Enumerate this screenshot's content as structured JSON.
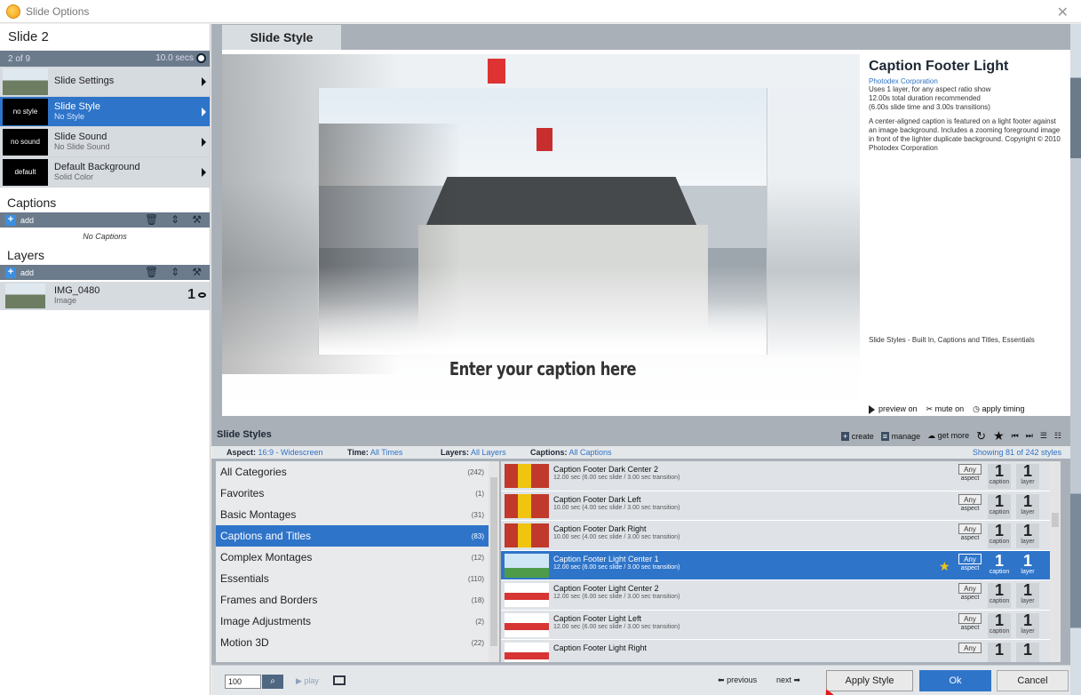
{
  "window": {
    "title": "Slide Options",
    "close": "✕"
  },
  "slide": {
    "title": "Slide 2",
    "position": "2 of 9",
    "duration": "10.0 secs"
  },
  "left_options": [
    {
      "thumb": "",
      "label": "Slide Settings",
      "sub": ""
    },
    {
      "thumb": "no style",
      "label": "Slide Style",
      "sub": "No Style"
    },
    {
      "thumb": "no sound",
      "label": "Slide Sound",
      "sub": "No Slide Sound"
    },
    {
      "thumb": "default",
      "label": "Default Background",
      "sub": "Solid Color"
    }
  ],
  "captions": {
    "title": "Captions",
    "add": "add",
    "empty": "No Captions"
  },
  "layers": {
    "title": "Layers",
    "add": "add",
    "items": [
      {
        "name": "IMG_0480",
        "type": "Image",
        "number": "1"
      }
    ]
  },
  "tab": {
    "label": "Slide Style"
  },
  "preview": {
    "caption": "Enter your caption here",
    "style_name": "Caption Footer Light",
    "company": "Photodex Corporation",
    "meta_lines": [
      "Uses 1 layer, for any aspect ratio show",
      "12.00s total duration recommended",
      "(6.00s slide time and 3.00s transitions)"
    ],
    "description": "A center-aligned caption is featured on a light footer against an image background. Includes a zooming foreground image in front of the lighter duplicate background. Copyright © 2010 Photodex Corporation",
    "categories": "Slide Styles - Built In, Captions and Titles, Essentials",
    "actions": {
      "preview": "preview on",
      "mute": "mute on",
      "timing": "apply timing"
    }
  },
  "styles_panel": {
    "title": "Slide Styles",
    "tools": {
      "create": "create",
      "manage": "manage",
      "get_more": "get more"
    },
    "filters": {
      "aspect_label": "Aspect:",
      "aspect_value": "16:9 - Widescreen",
      "time_label": "Time:",
      "time_value": "All Times",
      "layers_label": "Layers:",
      "layers_value": "All Layers",
      "captions_label": "Captions:",
      "captions_value": "All Captions",
      "showing": "Showing 81 of 242 styles"
    },
    "categories": [
      {
        "name": "All Categories",
        "count": "(242)"
      },
      {
        "name": "Favorites",
        "count": "(1)"
      },
      {
        "name": "Basic Montages",
        "count": "(31)"
      },
      {
        "name": "Captions and Titles",
        "count": "(83)"
      },
      {
        "name": "Complex Montages",
        "count": "(12)"
      },
      {
        "name": "Essentials",
        "count": "(110)"
      },
      {
        "name": "Frames and Borders",
        "count": "(18)"
      },
      {
        "name": "Image Adjustments",
        "count": "(2)"
      },
      {
        "name": "Motion 3D",
        "count": "(22)"
      }
    ],
    "selected_category": 3,
    "styles": [
      {
        "name": "Caption Footer Dark Center 2",
        "duration": "12.00 sec (6.00 sec slide / 3.00 sec transition)",
        "aspect": "Any",
        "aspect_label": "aspect",
        "captions": "1",
        "captions_label": "caption",
        "layers": "1",
        "layers_label": "layer"
      },
      {
        "name": "Caption Footer Dark Left",
        "duration": "10.00 sec (4.00 sec slide / 3.00 sec transition)",
        "aspect": "Any",
        "aspect_label": "aspect",
        "captions": "1",
        "captions_label": "caption",
        "layers": "1",
        "layers_label": "layer"
      },
      {
        "name": "Caption Footer Dark Right",
        "duration": "10.00 sec (4.00 sec slide / 3.00 sec transition)",
        "aspect": "Any",
        "aspect_label": "aspect",
        "captions": "1",
        "captions_label": "caption",
        "layers": "1",
        "layers_label": "layer"
      },
      {
        "name": "Caption Footer Light Center 1",
        "duration": "12.00 sec (6.00 sec slide / 3.00 sec transition)",
        "aspect": "Any",
        "aspect_label": "aspect",
        "captions": "1",
        "captions_label": "caption",
        "layers": "1",
        "layers_label": "layer"
      },
      {
        "name": "Caption Footer Light Center 2",
        "duration": "12.00 sec (6.00 sec slide / 3.00 sec transition)",
        "aspect": "Any",
        "aspect_label": "aspect",
        "captions": "1",
        "captions_label": "caption",
        "layers": "1",
        "layers_label": "layer"
      },
      {
        "name": "Caption Footer Light Left",
        "duration": "12.00 sec (6.00 sec slide / 3.00 sec transition)",
        "aspect": "Any",
        "aspect_label": "aspect",
        "captions": "1",
        "captions_label": "caption",
        "layers": "1",
        "layers_label": "layer"
      },
      {
        "name": "Caption Footer Light Right",
        "duration": "",
        "aspect": "Any",
        "aspect_label": "",
        "captions": "1",
        "captions_label": "",
        "layers": "1",
        "layers_label": ""
      }
    ],
    "selected_style": 3
  },
  "bottom": {
    "zoom": "100",
    "play": "play",
    "previous": "previous",
    "next": "next",
    "apply": "Apply Style",
    "ok": "Ok",
    "cancel": "Cancel"
  },
  "colors": {
    "accent": "#2e74c9",
    "panel": "#a9b0b8",
    "bar": "#6b7b8c",
    "favorite": "#f5c518"
  }
}
